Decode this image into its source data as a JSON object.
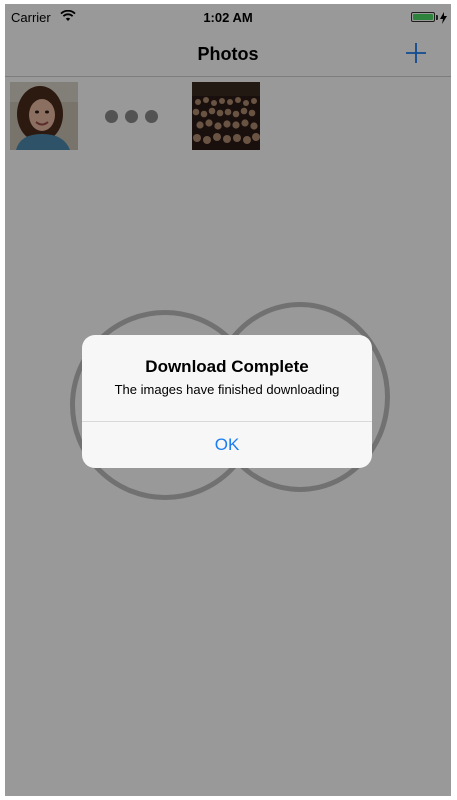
{
  "status_bar": {
    "carrier": "Carrier",
    "time": "1:02 AM",
    "wifi_icon": "wifi-icon",
    "battery_icon": "battery-icon",
    "charging_icon": "lightning-bolt-icon",
    "battery_color": "#4cd964"
  },
  "nav": {
    "title": "Photos",
    "add_icon": "plus-icon"
  },
  "photos": {
    "items": [
      {
        "name": "portrait-photo"
      },
      {
        "name": "crowd-photo"
      }
    ],
    "loading_icon": "ellipsis-loading-icon"
  },
  "alert": {
    "title": "Download Complete",
    "message": "The images have finished downloading",
    "ok_label": "OK"
  },
  "colors": {
    "tint": "#1a7ef2",
    "overlay": "rgba(0,0,0,0.40)"
  }
}
